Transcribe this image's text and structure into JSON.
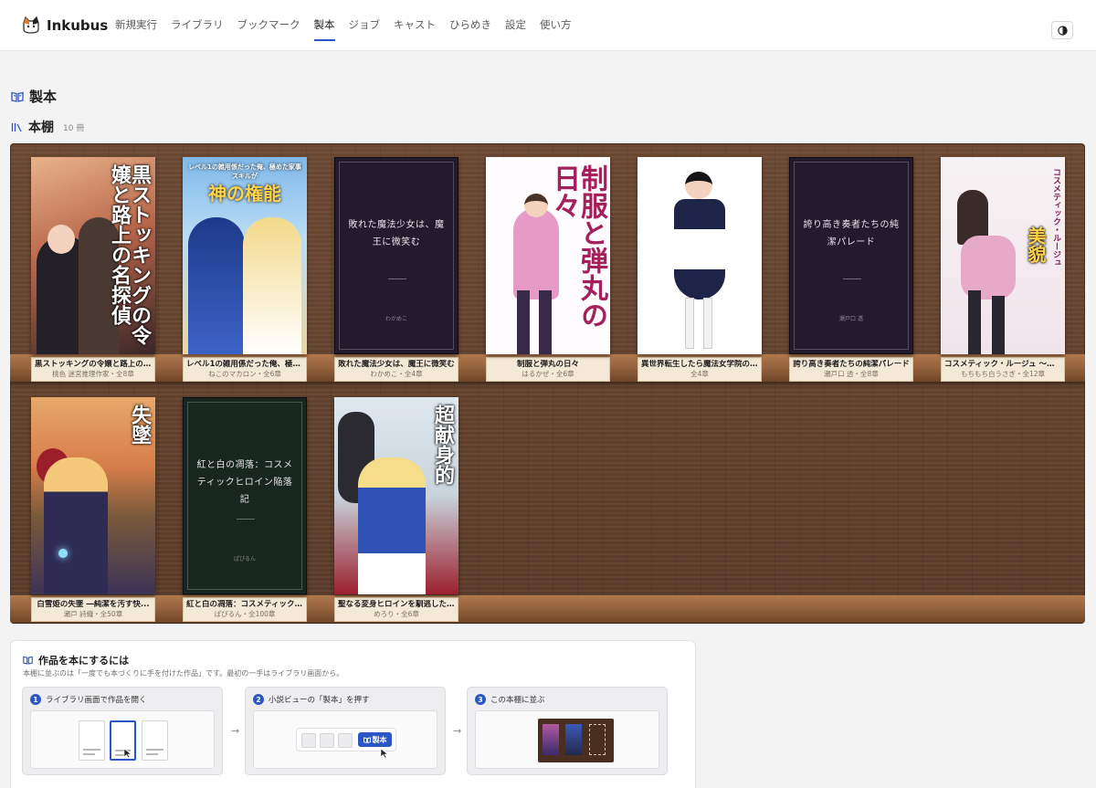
{
  "app": {
    "name": "Inkubus"
  },
  "nav": [
    {
      "label": "新規実行"
    },
    {
      "label": "ライブラリ"
    },
    {
      "label": "ブックマーク"
    },
    {
      "label": "製本",
      "active": true
    },
    {
      "label": "ジョブ"
    },
    {
      "label": "キャスト"
    },
    {
      "label": "ひらめき"
    },
    {
      "label": "設定"
    },
    {
      "label": "使い方"
    }
  ],
  "page": {
    "title": "製本"
  },
  "shelf": {
    "title": "本棚",
    "count": "10 冊",
    "books": [
      {
        "title": "黒ストッキングの令嬢と路上の名...",
        "meta": "桃色 迷宮推理作家・全8章",
        "cover": "art",
        "cover_title": "黒ストッキングの令嬢と路上の名探偵",
        "cover_author": "桃色 迷宮推理作家",
        "palette": [
          "#d9a07a",
          "#3b2a2a"
        ]
      },
      {
        "title": "レベル1の雑用係だった俺、極め...",
        "meta": "ねこのマカロン・全6章",
        "cover": "art",
        "cover_title": "神の権能",
        "cover_subtitle": "レベル1の雑用係だった俺、極めた家事スキルが",
        "palette": [
          "#7fb8e8",
          "#f3d98a"
        ]
      },
      {
        "title": "敗れた魔法少女は、魔王に微笑む",
        "meta": "わかめこ・全4章",
        "cover": "plain",
        "cover_title": "敗れた魔法少女は、魔王に微笑む",
        "cover_author": "わかめこ"
      },
      {
        "title": "制服と弾丸の日々",
        "meta": "はるかぜ・全6章",
        "cover": "art",
        "cover_title": "制服と弾丸の日々",
        "cover_author": "はるかぜ",
        "palette": [
          "#ffffff",
          "#b6428c"
        ]
      },
      {
        "title": "異世界転生したら魔法女学院の...",
        "meta": "全4章",
        "cover": "art",
        "palette": [
          "#ffffff",
          "#1d2447"
        ]
      },
      {
        "title": "誇り高き奏者たちの純潔パレード",
        "meta": "瀬戸口 透・全8章",
        "cover": "plain",
        "cover_title": "誇り高き奏者たちの純潔パレード",
        "cover_author": "瀬戸口 透"
      },
      {
        "title": "コスメティック・ルージュ 〜屈辱に...",
        "meta": "もちもち白うさぎ・全12章",
        "cover": "art",
        "cover_title": "美貌",
        "cover_subtitle": "コスメティック・ルージュ",
        "palette": [
          "#f4eef0",
          "#d77fb0"
        ]
      },
      {
        "title": "白雪姫の失墜 ―純潔を汚す快...",
        "meta": "瀬戸 詩織・全50章",
        "cover": "art",
        "cover_title": "失墜",
        "cover_author": "瀬戸 詩織",
        "palette": [
          "#e7a86a",
          "#3c3358"
        ]
      },
      {
        "title": "紅と白の凋落：コスメティックヒロ...",
        "meta": "ぱぴるん・全100章",
        "cover": "plain",
        "green": true,
        "cover_title": "紅と白の凋落：コスメティックヒロイン陥落記",
        "cover_author": "ぱぴるん"
      },
      {
        "title": "聖なる変身ヒロインを馴逃したら...",
        "meta": "めろり・全6章",
        "cover": "art",
        "cover_title": "超献身的",
        "cover_author": "めろり",
        "palette": [
          "#dfe8ef",
          "#9c1f2d"
        ]
      }
    ]
  },
  "help": {
    "title": "作品を本にするには",
    "desc": "本棚に並ぶのは「一度でも本づくりに手を付けた作品」です。最初の一手はライブラリ画面から。",
    "steps": [
      {
        "num": "1",
        "label": "ライブラリ画面で作品を開く"
      },
      {
        "num": "2",
        "label": "小説ビューの「製本」を押す",
        "button": "製本"
      },
      {
        "num": "3",
        "label": "この本棚に並ぶ"
      }
    ],
    "arrow": "→"
  },
  "colors": {
    "accent": "#2c56c4",
    "wood": "#5b3c29",
    "label_bg": "#f3e9d6"
  }
}
